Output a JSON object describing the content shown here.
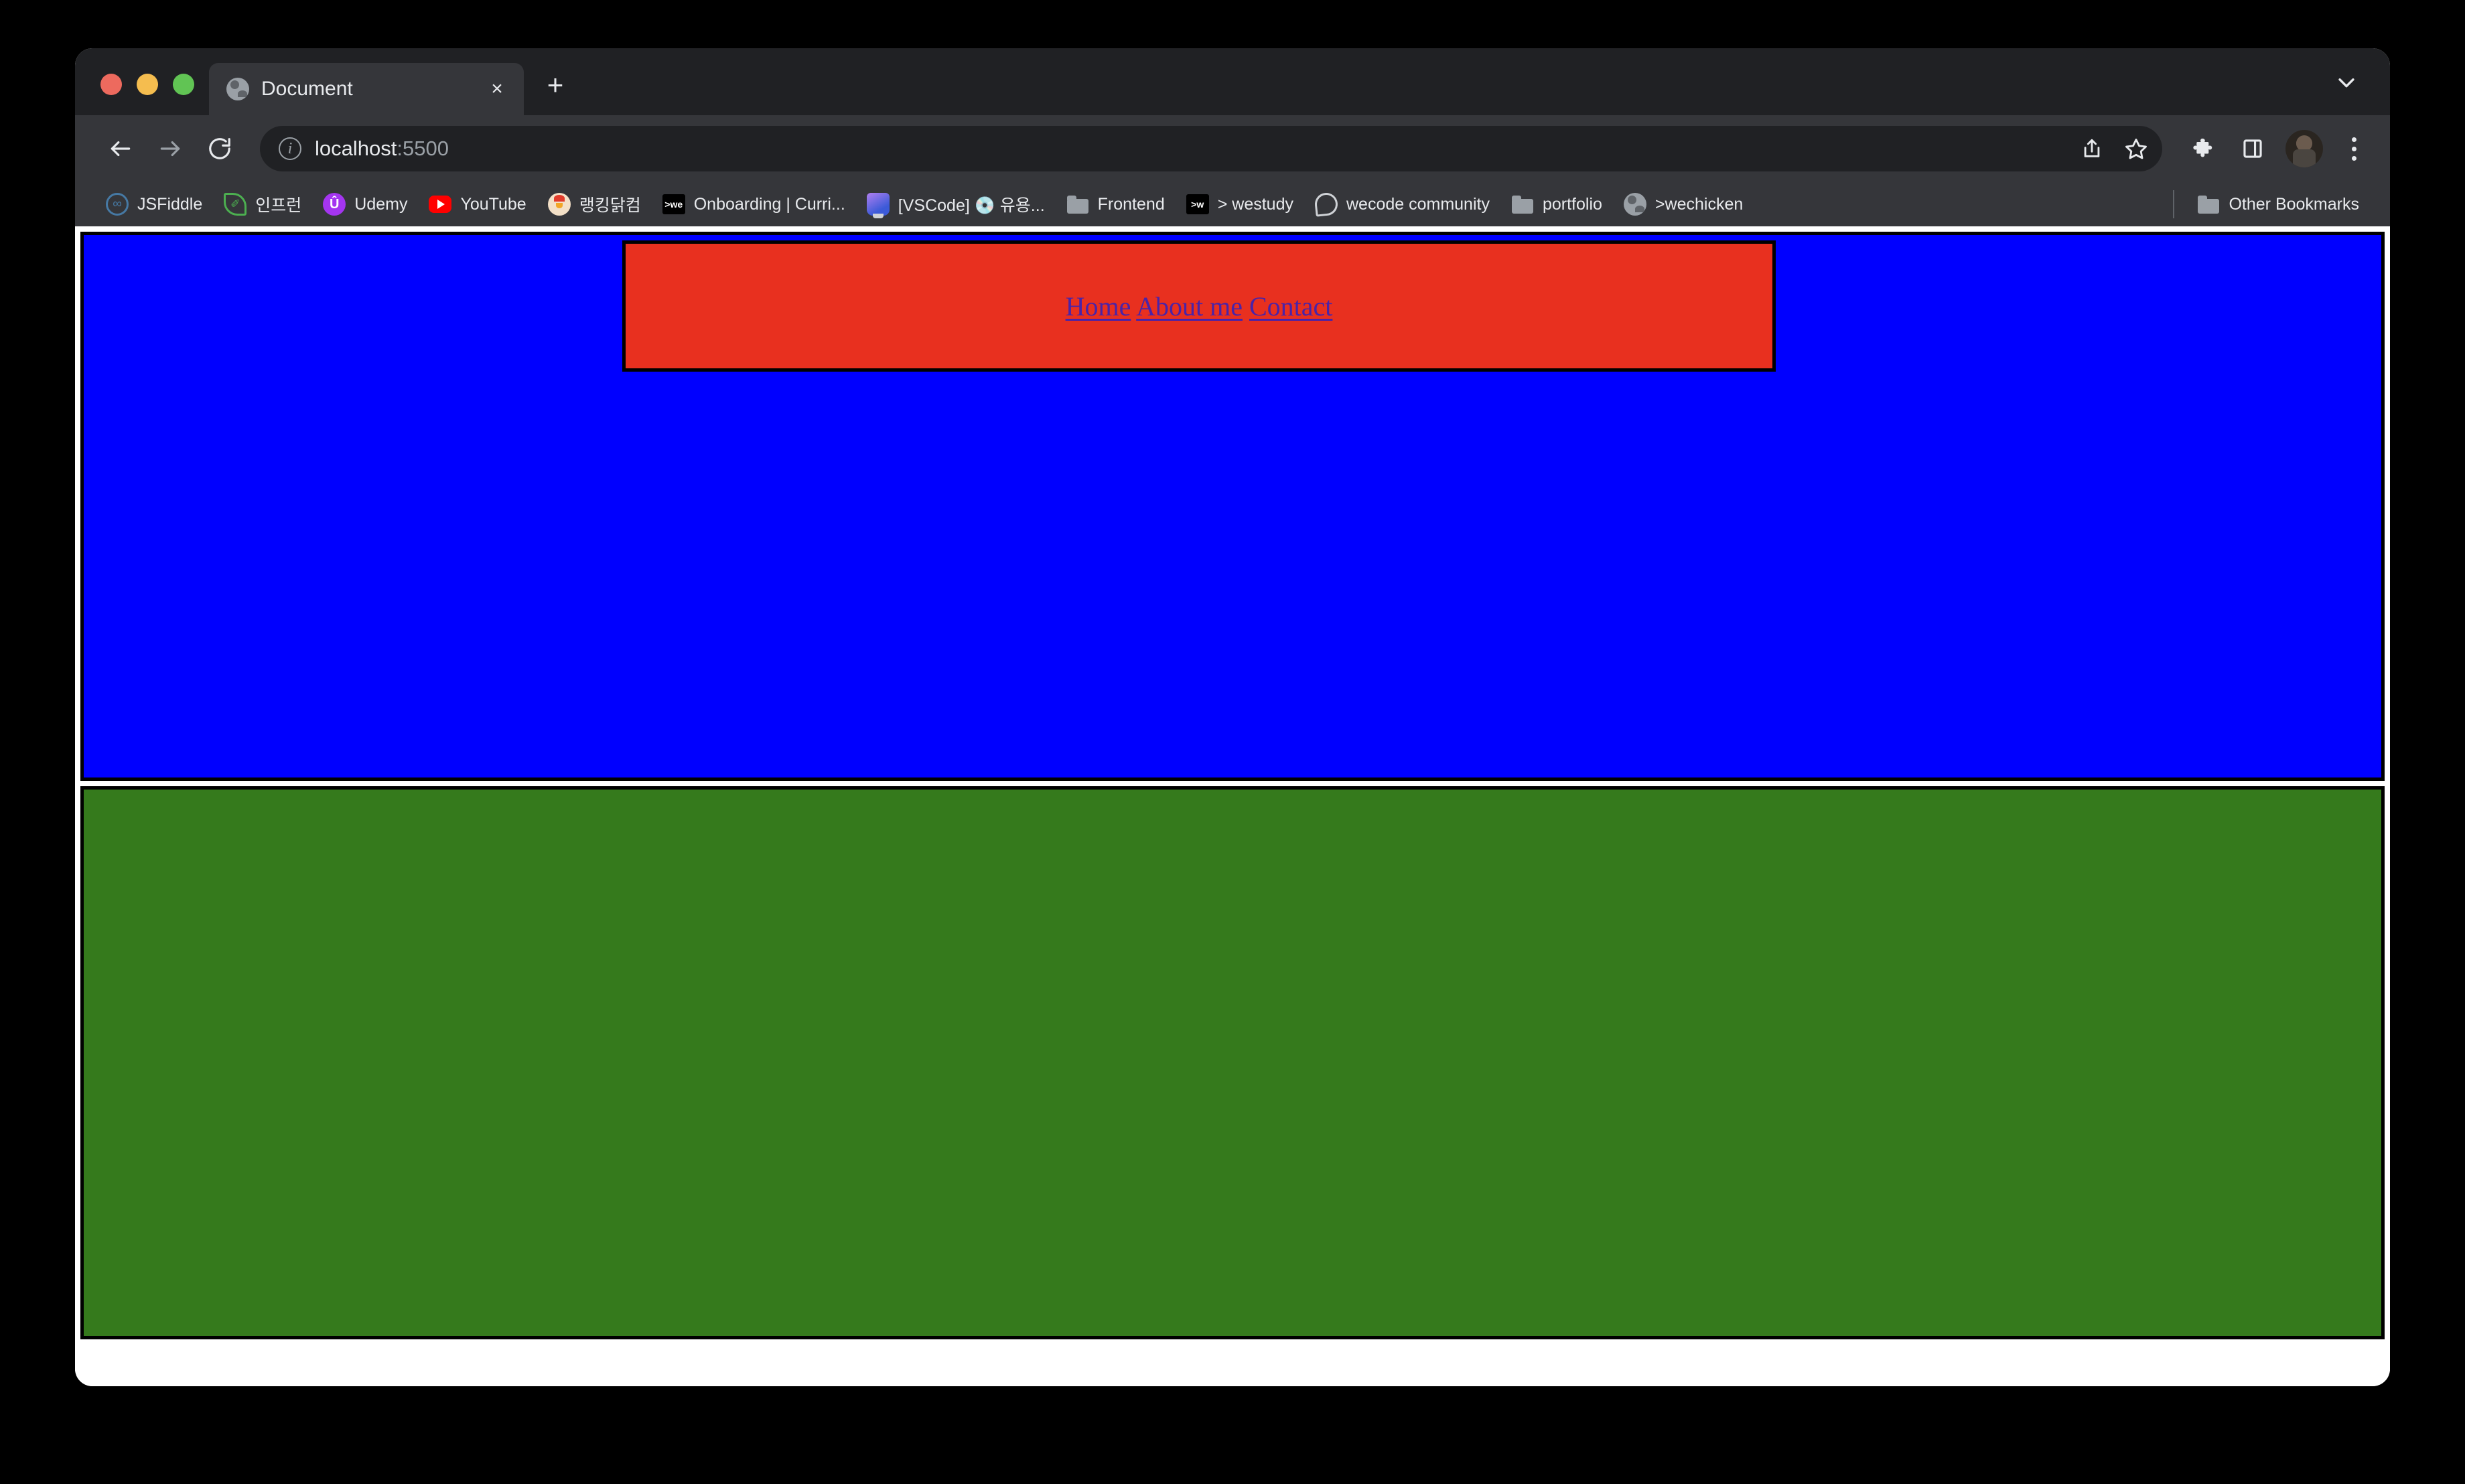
{
  "window": {
    "traffic_lights": [
      {
        "name": "close",
        "color": "#ED6A5E"
      },
      {
        "name": "minimize",
        "color": "#F5BD4F"
      },
      {
        "name": "maximize",
        "color": "#61C454"
      }
    ]
  },
  "tab_strip": {
    "active_tab": {
      "title": "Document",
      "favicon": "globe-icon",
      "close_label": "×"
    },
    "new_tab_label": "+",
    "tab_search_icon": "chevron-down-icon"
  },
  "toolbar": {
    "back_icon": "back-arrow-icon",
    "forward_icon": "forward-arrow-icon",
    "reload_icon": "reload-icon",
    "site_info_icon": "info-icon",
    "url_host": "localhost",
    "url_port": ":5500",
    "share_icon": "share-icon",
    "bookmark_star_icon": "star-icon",
    "extensions_icon": "puzzle-icon",
    "side_panel_icon": "side-panel-icon",
    "avatar_icon": "avatar",
    "menu_icon": "three-dots-icon"
  },
  "bookmarks_bar": {
    "items": [
      {
        "label": "JSFiddle",
        "icon": "jsfiddle-icon",
        "icon_class": "ico-jsfiddle",
        "glyph": "∞"
      },
      {
        "label": "인프런",
        "icon": "inflearn-icon",
        "icon_class": "ico-inflearn",
        "glyph": "✐"
      },
      {
        "label": "Udemy",
        "icon": "udemy-icon",
        "icon_class": "ico-udemy",
        "glyph": "Û"
      },
      {
        "label": "YouTube",
        "icon": "youtube-icon",
        "icon_class": "ico-youtube",
        "glyph": ""
      },
      {
        "label": "랭킹닭컴",
        "icon": "chicken-icon",
        "icon_class": "ico-chicken",
        "glyph": ""
      },
      {
        "label": "Onboarding | Curri...",
        "icon": "westudy-icon",
        "icon_class": "ico-we",
        "glyph": ">we"
      },
      {
        "label": "[VSCode] 💿 유용...",
        "icon": "vscode-icon",
        "icon_class": "ico-vscode",
        "glyph": ""
      },
      {
        "label": "Frontend",
        "icon": "folder-icon",
        "icon_class": "ico-folder",
        "glyph": ""
      },
      {
        "label": "> westudy",
        "icon": "westudy-icon",
        "icon_class": "ico-we",
        "glyph": ">w"
      },
      {
        "label": "wecode community",
        "icon": "wecode-icon",
        "icon_class": "ico-wecode",
        "glyph": ""
      },
      {
        "label": "portfolio",
        "icon": "folder-icon",
        "icon_class": "ico-folder",
        "glyph": ""
      },
      {
        "label": ">wechicken",
        "icon": "globe-icon",
        "icon_class": "ico-globe",
        "glyph": ""
      }
    ],
    "other_bookmarks": {
      "label": "Other Bookmarks",
      "icon": "folder-icon"
    }
  },
  "page": {
    "colors": {
      "blue_section": "#0000FF",
      "red_nav": "#E8301F",
      "green_section": "#357A1C",
      "border": "#000000",
      "link": "#4A23A8"
    },
    "nav_links": [
      {
        "label": "Home"
      },
      {
        "label": "About me"
      },
      {
        "label": "Contact"
      }
    ]
  }
}
